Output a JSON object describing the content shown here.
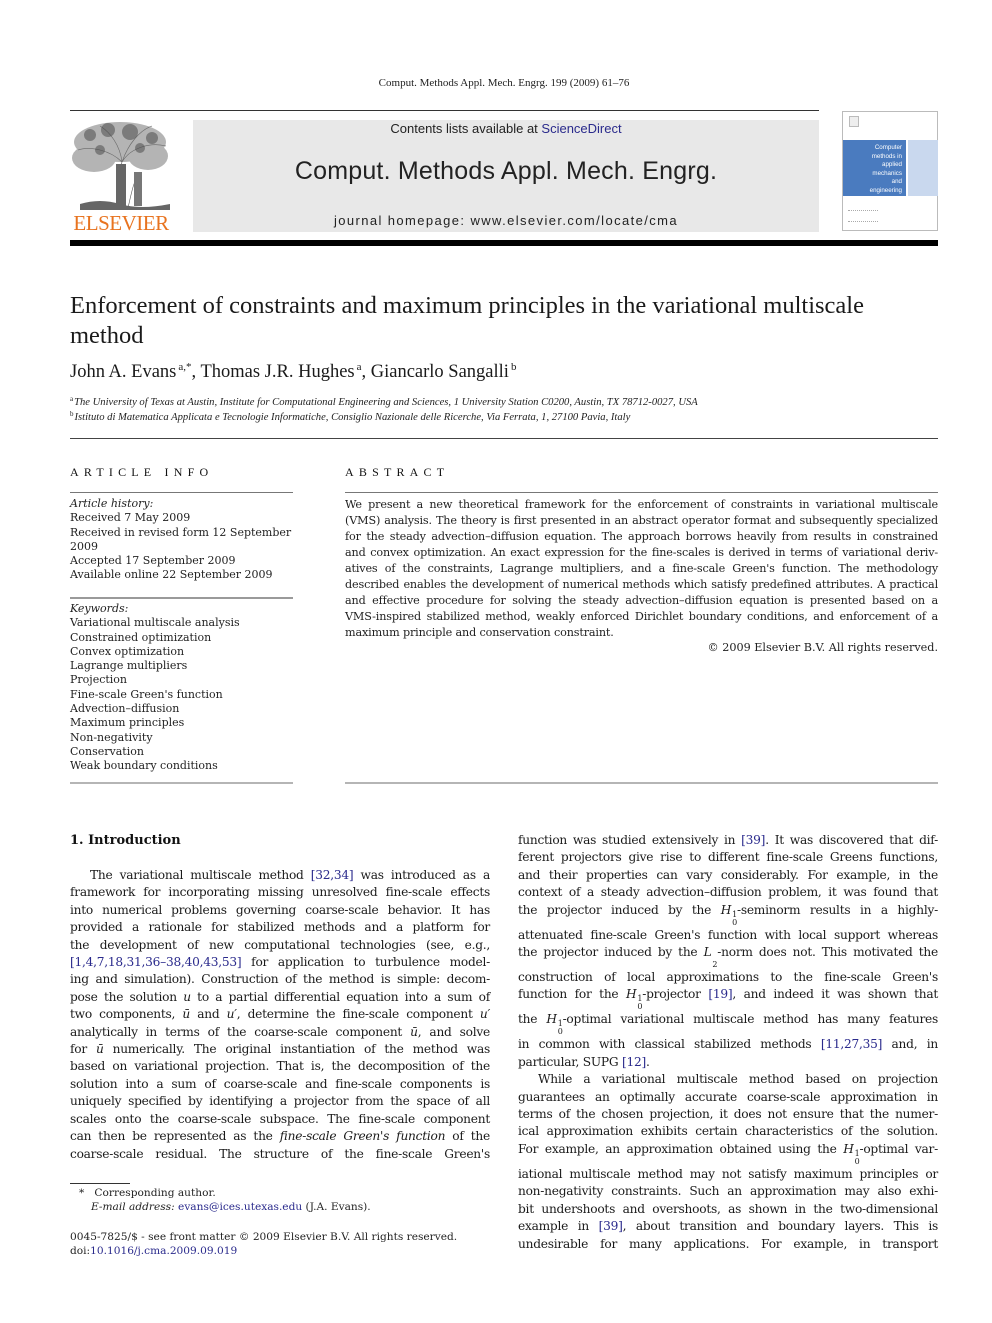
{
  "running_head": "Comput. Methods Appl. Mech. Engrg. 199 (2009) 61–76",
  "masthead": {
    "publisher_logo": "ELSEVIER",
    "contents_prefix": "Contents lists available at ",
    "contents_link": "ScienceDirect",
    "journal_title": "Comput. Methods Appl. Mech. Engrg.",
    "homepage": "journal homepage: www.elsevier.com/locate/cma",
    "cover_lines": [
      "Computer",
      "methods in",
      "applied",
      "mechanics",
      "and",
      "engineering"
    ],
    "colors": {
      "elsevier_orange": "#e8731f",
      "link_blue": "#2a2a8c",
      "cover_blue": "#4a7bbf",
      "masthead_gray": "#e8e8e8"
    }
  },
  "article": {
    "title": "Enforcement of constraints and maximum principles in the variational multiscale method",
    "authors": [
      {
        "name": "John A. Evans",
        "sup": "a,*"
      },
      {
        "name": "Thomas J.R. Hughes",
        "sup": "a"
      },
      {
        "name": "Giancarlo Sangalli",
        "sup": "b"
      }
    ],
    "affiliations": [
      {
        "key": "a",
        "text": "The University of Texas at Austin, Institute for Computational Engineering and Sciences, 1 University Station C0200, Austin, TX 78712-0027, USA"
      },
      {
        "key": "b",
        "text": "Istituto di Matematica Applicata e Tecnologie Informatiche, Consiglio Nazionale delle Ricerche, Via Ferrata, 1, 27100 Pavia, Italy"
      }
    ]
  },
  "article_info": {
    "heading": "ARTICLE INFO",
    "history_label": "Article history:",
    "history": [
      "Received 7 May 2009",
      "Received in revised form 12 September",
      "2009",
      "Accepted 17 September 2009",
      "Available online 22 September 2009"
    ],
    "keywords_label": "Keywords:",
    "keywords": [
      "Variational multiscale analysis",
      "Constrained optimization",
      "Convex optimization",
      "Lagrange multipliers",
      "Projection",
      "Fine-scale Green's function",
      "Advection–diffusion",
      "Maximum principles",
      "Non-negativity",
      "Conservation",
      "Weak boundary conditions"
    ]
  },
  "abstract": {
    "heading": "ABSTRACT",
    "lines": [
      "We present a new theoretical framework for the enforcement of constraints in variational multiscale",
      "(VMS) analysis. The theory is first presented in an abstract operator format and subsequently specialized",
      "for the steady advection–diffusion equation. The approach borrows heavily from results in constrained",
      "and convex optimization. An exact expression for the fine-scales is derived in terms of variational deriv-",
      "atives of the constraints, Lagrange multipliers, and a fine-scale Green's function. The methodology",
      "described enables the development of numerical methods which satisfy predefined attributes. A practical",
      "and effective procedure for solving the steady advection–diffusion equation is presented based on a",
      "VMS-inspired stabilized method, weakly enforced Dirichlet boundary conditions, and enforcement of a",
      "maximum principle and conservation constraint."
    ],
    "copyright": "© 2009 Elsevier B.V. All rights reserved."
  },
  "body": {
    "section_title": "1. Introduction",
    "left_column": [
      {
        "parts": [
          {
            "t": "The variational multiscale method "
          },
          {
            "t": "[32,34]",
            "link": true
          },
          {
            "t": " was introduced as a"
          }
        ],
        "indent": true
      },
      {
        "parts": [
          {
            "t": "framework for incorporating missing unresolved fine-scale effects"
          }
        ]
      },
      {
        "parts": [
          {
            "t": "into numerical problems governing coarse-scale behavior. It has"
          }
        ]
      },
      {
        "parts": [
          {
            "t": "provided a rationale for stabilized methods and a platform for"
          }
        ]
      },
      {
        "parts": [
          {
            "t": "the development of new computational technologies (see, e.g.,"
          }
        ]
      },
      {
        "parts": [
          {
            "t": "[1,4,7,18,31,36–38,40,43,53]",
            "link": true
          },
          {
            "t": " for application to turbulence model-"
          }
        ]
      },
      {
        "parts": [
          {
            "t": "ing and simulation). Construction of the method is simple: decom-"
          }
        ]
      },
      {
        "parts": [
          {
            "t": "pose the solution "
          },
          {
            "t": "u",
            "i": true
          },
          {
            "t": " to a partial differential equation into a sum of"
          }
        ]
      },
      {
        "parts": [
          {
            "t": "two components, "
          },
          {
            "t": "ū",
            "i": true
          },
          {
            "t": " and "
          },
          {
            "t": "u′",
            "i": true
          },
          {
            "t": ", determine the fine-scale component "
          },
          {
            "t": "u′",
            "i": true
          }
        ]
      },
      {
        "parts": [
          {
            "t": "analytically in terms of the coarse-scale component "
          },
          {
            "t": "ū",
            "i": true
          },
          {
            "t": ", and solve"
          }
        ]
      },
      {
        "parts": [
          {
            "t": "for "
          },
          {
            "t": "ū",
            "i": true
          },
          {
            "t": " numerically. The original instantiation of the method was"
          }
        ]
      },
      {
        "parts": [
          {
            "t": "based on variational projection. That is, the decomposition of the"
          }
        ]
      },
      {
        "parts": [
          {
            "t": "solution into a sum of coarse-scale and fine-scale components is"
          }
        ]
      },
      {
        "parts": [
          {
            "t": "uniquely specified by identifying a projector from the space of all"
          }
        ]
      },
      {
        "parts": [
          {
            "t": "scales onto the coarse-scale subspace. The fine-scale component"
          }
        ]
      },
      {
        "parts": [
          {
            "t": "can then be represented as the "
          },
          {
            "t": "fine-scale Green's function",
            "i": true
          },
          {
            "t": " of the"
          }
        ]
      },
      {
        "parts": [
          {
            "t": "coarse-scale residual. The structure of the fine-scale Green's"
          }
        ]
      }
    ],
    "right_column": [
      {
        "parts": [
          {
            "t": "function was studied extensively in "
          },
          {
            "t": "[39]",
            "link": true
          },
          {
            "t": ". It was discovered that dif-"
          }
        ]
      },
      {
        "parts": [
          {
            "t": "ferent projectors give rise to different fine-scale Greens functions,"
          }
        ]
      },
      {
        "parts": [
          {
            "t": "and their properties can vary considerably. For example, in the"
          }
        ]
      },
      {
        "parts": [
          {
            "t": "context of a steady advection–diffusion problem, it was found that"
          }
        ]
      },
      {
        "parts": [
          {
            "t": "the projector induced by the "
          },
          {
            "t": "H",
            "i": true,
            "sup": "1",
            "sub": "0"
          },
          {
            "t": "-seminorm results in a highly-"
          }
        ]
      },
      {
        "parts": [
          {
            "t": "attenuated fine-scale Green's function with local support whereas"
          }
        ]
      },
      {
        "parts": [
          {
            "t": "the projector induced by the "
          },
          {
            "t": "L",
            "i": true,
            "sub": "2"
          },
          {
            "t": "-norm does not. This motivated the"
          }
        ]
      },
      {
        "parts": [
          {
            "t": "construction of local approximations to the fine-scale Green's"
          }
        ]
      },
      {
        "parts": [
          {
            "t": "function for the "
          },
          {
            "t": "H",
            "i": true,
            "sup": "1",
            "sub": "0"
          },
          {
            "t": "-projector "
          },
          {
            "t": "[19]",
            "link": true
          },
          {
            "t": ", and indeed it was shown that"
          }
        ]
      },
      {
        "parts": [
          {
            "t": "the "
          },
          {
            "t": "H",
            "i": true,
            "sup": "1",
            "sub": "0"
          },
          {
            "t": "-optimal variational multiscale method has many features"
          }
        ]
      },
      {
        "parts": [
          {
            "t": "in common with classical stabilized methods "
          },
          {
            "t": "[11,27,35]",
            "link": true
          },
          {
            "t": " and, in"
          }
        ]
      },
      {
        "parts": [
          {
            "t": "particular, SUPG "
          },
          {
            "t": "[12]",
            "link": true
          },
          {
            "t": "."
          }
        ],
        "end": true
      },
      {
        "parts": [
          {
            "t": "While a variational multiscale method based on projection"
          }
        ],
        "indent": true
      },
      {
        "parts": [
          {
            "t": "guarantees an optimally accurate coarse-scale approximation in"
          }
        ]
      },
      {
        "parts": [
          {
            "t": "terms of the chosen projection, it does not ensure that the numer-"
          }
        ]
      },
      {
        "parts": [
          {
            "t": "ical approximation exhibits certain characteristics of the solution."
          }
        ]
      },
      {
        "parts": [
          {
            "t": "For example, an approximation obtained using the "
          },
          {
            "t": "H",
            "i": true,
            "sup": "1",
            "sub": "0"
          },
          {
            "t": "-optimal var-"
          }
        ]
      },
      {
        "parts": [
          {
            "t": "iational multiscale method may not satisfy maximum principles or"
          }
        ]
      },
      {
        "parts": [
          {
            "t": "non-negativity constraints. Such an approximation may also exhi-"
          }
        ]
      },
      {
        "parts": [
          {
            "t": "bit undershoots and overshoots, as shown in the two-dimensional"
          }
        ]
      },
      {
        "parts": [
          {
            "t": "example in "
          },
          {
            "t": "[39]",
            "link": true
          },
          {
            "t": ", about transition and boundary layers. This is"
          }
        ]
      },
      {
        "parts": [
          {
            "t": "undesirable for many applications. For example, in transport"
          }
        ]
      }
    ]
  },
  "footnotes": {
    "corresponding_mark": "*",
    "corresponding_text": "Corresponding author.",
    "email_label": "E-mail address:",
    "email": "evans@ices.utexas.edu",
    "email_suffix": " (J.A. Evans).",
    "issn_line": "0045-7825/$ - see front matter © 2009 Elsevier B.V. All rights reserved.",
    "doi_label": "doi:",
    "doi": "10.1016/j.cma.2009.09.019"
  }
}
